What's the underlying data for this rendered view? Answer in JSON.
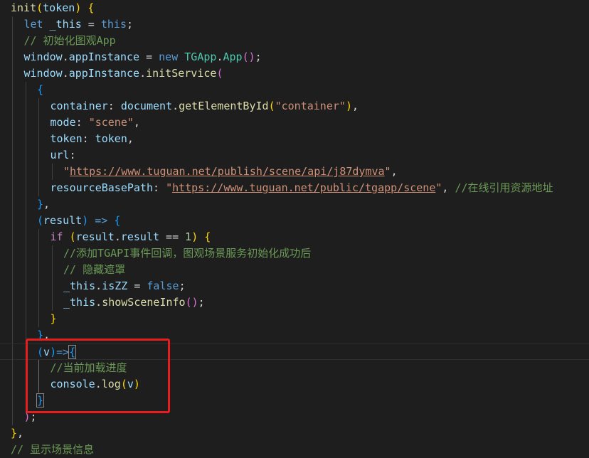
{
  "editor": {
    "annotation": {
      "color": "#e81e1e",
      "label": "highlighted onProgress callback"
    },
    "lines": [
      {
        "indent": 0,
        "tokens": [
          [
            "init",
            "fn"
          ],
          [
            "(",
            "b1"
          ],
          [
            "token",
            "var"
          ],
          [
            ")",
            "b1"
          ],
          [
            " ",
            "pn"
          ],
          [
            "{",
            "b1"
          ]
        ]
      },
      {
        "indent": 1,
        "tokens": [
          [
            "let",
            "kw"
          ],
          [
            " ",
            "pn"
          ],
          [
            "_this",
            "var"
          ],
          [
            " = ",
            "op"
          ],
          [
            "this",
            "kw"
          ],
          [
            ";",
            "pn"
          ]
        ]
      },
      {
        "indent": 1,
        "tokens": [
          [
            "// 初始化图观App",
            "com"
          ]
        ]
      },
      {
        "indent": 1,
        "tokens": [
          [
            "window",
            "var"
          ],
          [
            ".",
            "pn"
          ],
          [
            "appInstance",
            "var"
          ],
          [
            " = ",
            "op"
          ],
          [
            "new",
            "kw"
          ],
          [
            " ",
            "pn"
          ],
          [
            "TGApp",
            "cls"
          ],
          [
            ".",
            "pn"
          ],
          [
            "App",
            "cls"
          ],
          [
            "(",
            "b2"
          ],
          [
            ")",
            "b2"
          ],
          [
            ";",
            "pn"
          ]
        ]
      },
      {
        "indent": 1,
        "tokens": [
          [
            "window",
            "var"
          ],
          [
            ".",
            "pn"
          ],
          [
            "appInstance",
            "var"
          ],
          [
            ".",
            "pn"
          ],
          [
            "initService",
            "fn"
          ],
          [
            "(",
            "b2"
          ]
        ]
      },
      {
        "indent": 2,
        "tokens": [
          [
            "{",
            "b3"
          ]
        ]
      },
      {
        "indent": 3,
        "tokens": [
          [
            "container",
            "var"
          ],
          [
            ": ",
            "pn"
          ],
          [
            "document",
            "var"
          ],
          [
            ".",
            "pn"
          ],
          [
            "getElementById",
            "fn"
          ],
          [
            "(",
            "b1"
          ],
          [
            "\"container\"",
            "str"
          ],
          [
            ")",
            "b1"
          ],
          [
            ",",
            "pn"
          ]
        ]
      },
      {
        "indent": 3,
        "tokens": [
          [
            "mode",
            "var"
          ],
          [
            ": ",
            "pn"
          ],
          [
            "\"scene\"",
            "str"
          ],
          [
            ",",
            "pn"
          ]
        ]
      },
      {
        "indent": 3,
        "tokens": [
          [
            "token",
            "var"
          ],
          [
            ": ",
            "pn"
          ],
          [
            "token",
            "var"
          ],
          [
            ",",
            "pn"
          ]
        ]
      },
      {
        "indent": 3,
        "tokens": [
          [
            "url",
            "var"
          ],
          [
            ":",
            "pn"
          ]
        ]
      },
      {
        "indent": 4,
        "tokens": [
          [
            "\"",
            "str"
          ],
          [
            "https://www.tuguan.net/publish/scene/api/j87dymva",
            "url"
          ],
          [
            "\"",
            "str"
          ],
          [
            ",",
            "pn"
          ]
        ]
      },
      {
        "indent": 3,
        "tokens": [
          [
            "resourceBasePath",
            "var"
          ],
          [
            ": ",
            "pn"
          ],
          [
            "\"",
            "str"
          ],
          [
            "https://www.tuguan.net/public/tgapp/scene",
            "url"
          ],
          [
            "\"",
            "str"
          ],
          [
            ", ",
            "pn"
          ],
          [
            "//在线引用资源地址",
            "com"
          ]
        ]
      },
      {
        "indent": 2,
        "tokens": [
          [
            "}",
            "b3"
          ],
          [
            ",",
            "pn"
          ]
        ]
      },
      {
        "indent": 2,
        "tokens": [
          [
            "(",
            "b3"
          ],
          [
            "result",
            "var"
          ],
          [
            ")",
            "b3"
          ],
          [
            " ",
            "pn"
          ],
          [
            "=>",
            "kw"
          ],
          [
            " ",
            "pn"
          ],
          [
            "{",
            "b3"
          ]
        ]
      },
      {
        "indent": 3,
        "tokens": [
          [
            "if",
            "ctl"
          ],
          [
            " ",
            "pn"
          ],
          [
            "(",
            "b1"
          ],
          [
            "result",
            "var"
          ],
          [
            ".",
            "pn"
          ],
          [
            "result",
            "var"
          ],
          [
            " == ",
            "op"
          ],
          [
            "1",
            "num"
          ],
          [
            ")",
            "b1"
          ],
          [
            " ",
            "pn"
          ],
          [
            "{",
            "b1"
          ]
        ]
      },
      {
        "indent": 4,
        "tokens": [
          [
            "//添加TGAPI事件回调，图观场景服务初始化成功后",
            "com"
          ]
        ]
      },
      {
        "indent": 4,
        "tokens": [
          [
            "// 隐藏遮罩",
            "com"
          ]
        ]
      },
      {
        "indent": 4,
        "tokens": [
          [
            "_this",
            "var"
          ],
          [
            ".",
            "pn"
          ],
          [
            "isZZ",
            "var"
          ],
          [
            " = ",
            "op"
          ],
          [
            "false",
            "kw"
          ],
          [
            ";",
            "pn"
          ]
        ]
      },
      {
        "indent": 4,
        "tokens": [
          [
            "_this",
            "var"
          ],
          [
            ".",
            "pn"
          ],
          [
            "showSceneInfo",
            "fn"
          ],
          [
            "(",
            "b2"
          ],
          [
            ")",
            "b2"
          ],
          [
            ";",
            "pn"
          ]
        ]
      },
      {
        "indent": 3,
        "tokens": [
          [
            "}",
            "b1"
          ]
        ]
      },
      {
        "indent": 2,
        "tokens": [
          [
            "}",
            "b3"
          ],
          [
            ",",
            "pn"
          ]
        ]
      },
      {
        "indent": 2,
        "current": true,
        "tokens": [
          [
            "(",
            "b3"
          ],
          [
            "v",
            "var"
          ],
          [
            ")",
            "b3"
          ],
          [
            "=>",
            "kw"
          ],
          [
            "{",
            "b3m"
          ]
        ]
      },
      {
        "indent": 3,
        "tokens": [
          [
            "//当前加载进度",
            "com"
          ]
        ]
      },
      {
        "indent": 3,
        "tokens": [
          [
            "console",
            "var"
          ],
          [
            ".",
            "pn"
          ],
          [
            "log",
            "fn"
          ],
          [
            "(",
            "b1"
          ],
          [
            "v",
            "var"
          ],
          [
            ")",
            "b1"
          ]
        ]
      },
      {
        "indent": 2,
        "tokens": [
          [
            "}",
            "b3m"
          ]
        ]
      },
      {
        "indent": 1,
        "tokens": [
          [
            ")",
            "b2"
          ],
          [
            ";",
            "pn"
          ]
        ]
      },
      {
        "indent": 0,
        "tokens": [
          [
            "}",
            "b1"
          ],
          [
            ",",
            "pn"
          ]
        ]
      },
      {
        "indent": 0,
        "tokens": [
          [
            "// 显示场景信息",
            "com"
          ]
        ]
      }
    ]
  }
}
